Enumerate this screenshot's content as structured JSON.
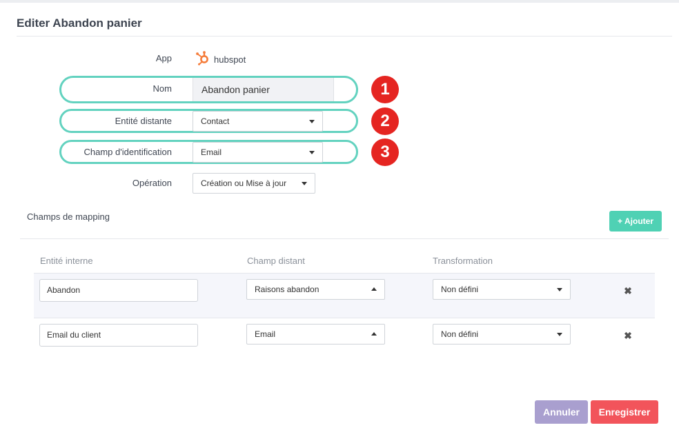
{
  "page": {
    "title": "Editer Abandon panier"
  },
  "form": {
    "app_label": "App",
    "app_name": "hubspot",
    "app_icon": "hubspot-sprocket-icon",
    "nom_label": "Nom",
    "nom_value": "Abandon panier",
    "entite_label": "Entité distante",
    "entite_value": "Contact",
    "champ_label": "Champ d'identification",
    "champ_value": "Email",
    "operation_label": "Opération",
    "operation_value": "Création ou Mise à jour"
  },
  "annotations": [
    "1",
    "2",
    "3"
  ],
  "mapping": {
    "title": "Champs de mapping",
    "add_label": "Ajouter",
    "columns": [
      "Entité interne",
      "Champ distant",
      "Transformation"
    ],
    "rows": [
      {
        "interne": "Abandon",
        "distant": "Raisons abandon",
        "transformation": "Non défini"
      },
      {
        "interne": "Email du client",
        "distant": "Email",
        "transformation": "Non défini"
      }
    ]
  },
  "footer": {
    "cancel_label": "Annuler",
    "save_label": "Enregistrer"
  },
  "colors": {
    "accent": "#4fd1b4",
    "highlight": "#62d2bf",
    "badge": "#e52521",
    "cancel": "#a99fcf",
    "save": "#f2545b",
    "hubspot": "#f57c3a"
  }
}
